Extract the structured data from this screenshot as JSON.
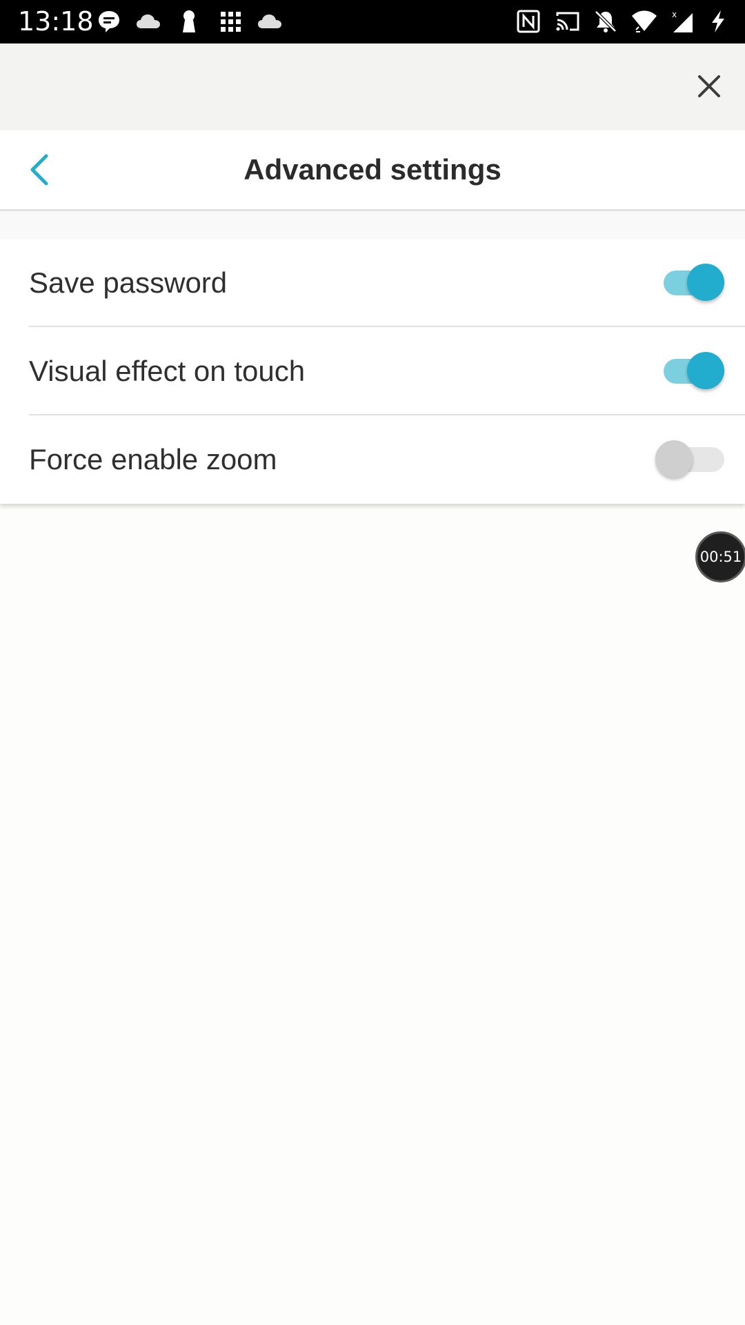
{
  "status_bar": {
    "time": "13:18",
    "left_icons": [
      "chat-bubble-icon",
      "cloud-icon",
      "keyhole-icon",
      "app-grid-icon",
      "cloud-icon"
    ],
    "right_icons": [
      "nfc-icon",
      "cast-icon",
      "bell-off-icon",
      "wifi-icon",
      "signal-icon",
      "charging-bolt-icon"
    ]
  },
  "top_bar": {
    "close_icon": "close-icon"
  },
  "header": {
    "title": "Advanced settings",
    "back_icon": "chevron-left-icon"
  },
  "settings": [
    {
      "label": "Save password",
      "enabled": true
    },
    {
      "label": "Visual effect on touch",
      "enabled": true
    },
    {
      "label": "Force enable zoom",
      "enabled": false
    }
  ],
  "timer": {
    "text": "00:51"
  },
  "colors": {
    "accent": "#22acce",
    "accent_track": "#7ccfde",
    "toggle_off_thumb": "#cfcfcf",
    "toggle_off_track": "#e6e6e6",
    "text_primary": "#2f2f2f",
    "status_bar_bg": "#000000"
  }
}
